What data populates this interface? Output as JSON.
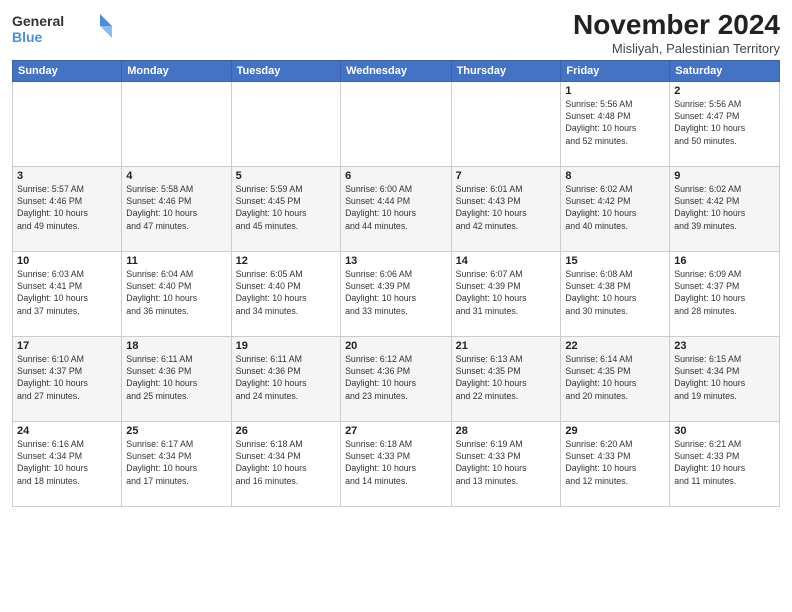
{
  "header": {
    "logo_general": "General",
    "logo_blue": "Blue",
    "month_title": "November 2024",
    "location": "Misliyah, Palestinian Territory"
  },
  "days_of_week": [
    "Sunday",
    "Monday",
    "Tuesday",
    "Wednesday",
    "Thursday",
    "Friday",
    "Saturday"
  ],
  "weeks": [
    [
      {
        "day": "",
        "info": ""
      },
      {
        "day": "",
        "info": ""
      },
      {
        "day": "",
        "info": ""
      },
      {
        "day": "",
        "info": ""
      },
      {
        "day": "",
        "info": ""
      },
      {
        "day": "1",
        "info": "Sunrise: 5:56 AM\nSunset: 4:48 PM\nDaylight: 10 hours\nand 52 minutes."
      },
      {
        "day": "2",
        "info": "Sunrise: 5:56 AM\nSunset: 4:47 PM\nDaylight: 10 hours\nand 50 minutes."
      }
    ],
    [
      {
        "day": "3",
        "info": "Sunrise: 5:57 AM\nSunset: 4:46 PM\nDaylight: 10 hours\nand 49 minutes."
      },
      {
        "day": "4",
        "info": "Sunrise: 5:58 AM\nSunset: 4:46 PM\nDaylight: 10 hours\nand 47 minutes."
      },
      {
        "day": "5",
        "info": "Sunrise: 5:59 AM\nSunset: 4:45 PM\nDaylight: 10 hours\nand 45 minutes."
      },
      {
        "day": "6",
        "info": "Sunrise: 6:00 AM\nSunset: 4:44 PM\nDaylight: 10 hours\nand 44 minutes."
      },
      {
        "day": "7",
        "info": "Sunrise: 6:01 AM\nSunset: 4:43 PM\nDaylight: 10 hours\nand 42 minutes."
      },
      {
        "day": "8",
        "info": "Sunrise: 6:02 AM\nSunset: 4:42 PM\nDaylight: 10 hours\nand 40 minutes."
      },
      {
        "day": "9",
        "info": "Sunrise: 6:02 AM\nSunset: 4:42 PM\nDaylight: 10 hours\nand 39 minutes."
      }
    ],
    [
      {
        "day": "10",
        "info": "Sunrise: 6:03 AM\nSunset: 4:41 PM\nDaylight: 10 hours\nand 37 minutes."
      },
      {
        "day": "11",
        "info": "Sunrise: 6:04 AM\nSunset: 4:40 PM\nDaylight: 10 hours\nand 36 minutes."
      },
      {
        "day": "12",
        "info": "Sunrise: 6:05 AM\nSunset: 4:40 PM\nDaylight: 10 hours\nand 34 minutes."
      },
      {
        "day": "13",
        "info": "Sunrise: 6:06 AM\nSunset: 4:39 PM\nDaylight: 10 hours\nand 33 minutes."
      },
      {
        "day": "14",
        "info": "Sunrise: 6:07 AM\nSunset: 4:39 PM\nDaylight: 10 hours\nand 31 minutes."
      },
      {
        "day": "15",
        "info": "Sunrise: 6:08 AM\nSunset: 4:38 PM\nDaylight: 10 hours\nand 30 minutes."
      },
      {
        "day": "16",
        "info": "Sunrise: 6:09 AM\nSunset: 4:37 PM\nDaylight: 10 hours\nand 28 minutes."
      }
    ],
    [
      {
        "day": "17",
        "info": "Sunrise: 6:10 AM\nSunset: 4:37 PM\nDaylight: 10 hours\nand 27 minutes."
      },
      {
        "day": "18",
        "info": "Sunrise: 6:11 AM\nSunset: 4:36 PM\nDaylight: 10 hours\nand 25 minutes."
      },
      {
        "day": "19",
        "info": "Sunrise: 6:11 AM\nSunset: 4:36 PM\nDaylight: 10 hours\nand 24 minutes."
      },
      {
        "day": "20",
        "info": "Sunrise: 6:12 AM\nSunset: 4:36 PM\nDaylight: 10 hours\nand 23 minutes."
      },
      {
        "day": "21",
        "info": "Sunrise: 6:13 AM\nSunset: 4:35 PM\nDaylight: 10 hours\nand 22 minutes."
      },
      {
        "day": "22",
        "info": "Sunrise: 6:14 AM\nSunset: 4:35 PM\nDaylight: 10 hours\nand 20 minutes."
      },
      {
        "day": "23",
        "info": "Sunrise: 6:15 AM\nSunset: 4:34 PM\nDaylight: 10 hours\nand 19 minutes."
      }
    ],
    [
      {
        "day": "24",
        "info": "Sunrise: 6:16 AM\nSunset: 4:34 PM\nDaylight: 10 hours\nand 18 minutes."
      },
      {
        "day": "25",
        "info": "Sunrise: 6:17 AM\nSunset: 4:34 PM\nDaylight: 10 hours\nand 17 minutes."
      },
      {
        "day": "26",
        "info": "Sunrise: 6:18 AM\nSunset: 4:34 PM\nDaylight: 10 hours\nand 16 minutes."
      },
      {
        "day": "27",
        "info": "Sunrise: 6:18 AM\nSunset: 4:33 PM\nDaylight: 10 hours\nand 14 minutes."
      },
      {
        "day": "28",
        "info": "Sunrise: 6:19 AM\nSunset: 4:33 PM\nDaylight: 10 hours\nand 13 minutes."
      },
      {
        "day": "29",
        "info": "Sunrise: 6:20 AM\nSunset: 4:33 PM\nDaylight: 10 hours\nand 12 minutes."
      },
      {
        "day": "30",
        "info": "Sunrise: 6:21 AM\nSunset: 4:33 PM\nDaylight: 10 hours\nand 11 minutes."
      }
    ]
  ]
}
